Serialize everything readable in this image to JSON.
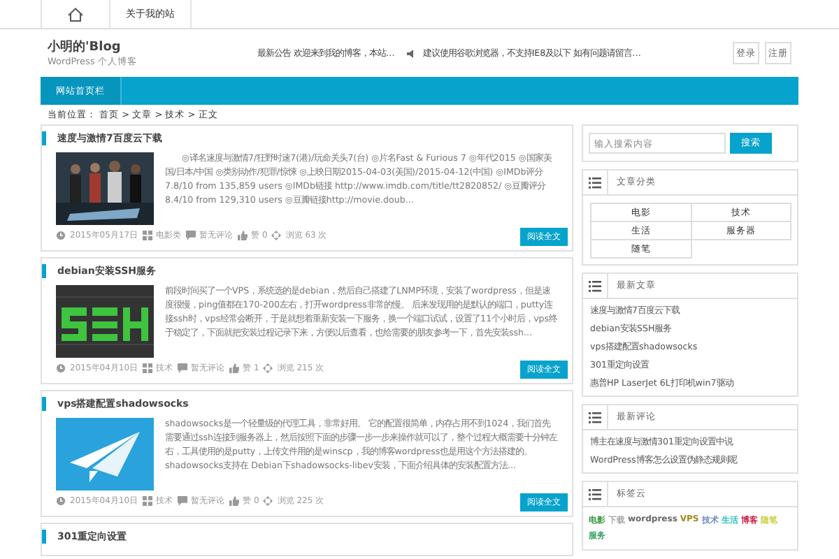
{
  "top_nav": {
    "label": "关于我的站"
  },
  "header": {
    "site_name": "小明的'Blog",
    "tagline": "WordPress 个人博客",
    "notices": [
      "最新公告 欢迎来到我的博客，本站…",
      "建议使用谷歌浏览器，不支持IE8及以下 如有问题请留言…"
    ],
    "buttons": [
      "登录",
      "注册"
    ]
  },
  "nav_bar": {
    "items": [
      {
        "label": "网站首页栏",
        "selected": true
      }
    ]
  },
  "breadcrumb": "当前位置： 首页 > 文章 > 技术 > 正文",
  "posts": [
    {
      "title": "速度与激情7百度云下载",
      "excerpt": "　　◎译名速度与激情7/狂野时速7(港)/玩命关头7(台) ◎片名Fast & Furious 7 ◎年代2015 ◎国家美国/日本/中国 ◎类别动作/犯罪/惊悚 ◎上映日期2015-04-03(美国)/2015-04-12(中国) ◎IMDb评分  7.8/10 from 135,859 users ◎IMDb链接  http://www.imdb.com/title/tt2820852/ ◎豆瓣评分8.4/10 from 129,310 users ◎豆瓣链接http://movie.doub...",
      "date": "2015年05月17日",
      "category": "电影类",
      "comments": "暂无评论",
      "likes": "赞 0",
      "views": "浏览 63 次",
      "button": "阅读全文"
    },
    {
      "title": "debian安装SSH服务",
      "excerpt": "前段时间买了一个VPS，系统选的是debian，然后自己搭建了LNMP环境，安装了wordpress，但是速度很慢，ping值都在170-200左右，打开wordpress非常的慢。 后来发现用的是默认的端口，putty连接ssh时，vps经常会断开，于是就想着重新安装一下服务，换一个端口试试，设置了11个小时后，vps终于稳定了，下面就把安装过程记录下来，方便以后查看，也给需要的朋友参考一下，首先安装ssh...",
      "date": "2015年04月10日",
      "category": "技术",
      "comments": "暂无评论",
      "likes": "赞 1",
      "views": "浏览 215 次",
      "button": "阅读全文"
    },
    {
      "title": "vps搭建配置shadowsocks",
      "excerpt": "shadowsocks是一个轻量级的代理工具，非常好用。 它的配置很简单，内存占用不到1024，我们首先需要通过ssh连接到服务器上，然后按照下面的步骤一步一步来操作就可以了，整个过程大概需要十分钟左右，工具使用的是putty，上传文件用的是winscp，我的博客wordpress也是用这个方法搭建的。 shadowsocks支持在 Debian下shadowsocks-libev安装，下面介绍具体的安装配置方法...",
      "date": "2015年04月10日",
      "category": "技术",
      "comments": "暂无评论",
      "likes": "赞 0",
      "views": "浏览 225 次",
      "button": "阅读全文"
    },
    {
      "title": "301重定向设置"
    }
  ],
  "sidebar": {
    "search": {
      "placeholder": "输入搜索内容",
      "button": "搜索"
    },
    "widgets": [
      {
        "kind": "categories",
        "title": "文章分类",
        "items": [
          "电影",
          "技术",
          "生活",
          "服务器",
          "随笔"
        ]
      },
      {
        "kind": "list",
        "title": "最新文章",
        "items": [
          "速度与激情7百度云下载",
          "debian安装SSH服务",
          "vps搭建配置shadowsocks",
          "301重定向设置",
          "惠普HP LaserJet 6L打印机win7驱动"
        ]
      },
      {
        "kind": "list",
        "title": "最新评论",
        "items": [
          "博主在速度与激情301重定向设置中说",
          "WordPress博客怎么设置伪静态规则呢"
        ]
      },
      {
        "kind": "tags",
        "title": "标签云",
        "items": [
          {
            "label": "电影",
            "color": "#3a9a3a"
          },
          {
            "label": "下载",
            "color": "#aaaaaa"
          },
          {
            "label": "wordpress",
            "color": "#666666"
          },
          {
            "label": "VPS",
            "color": "#a08a20"
          },
          {
            "label": "技术",
            "color": "#6a8ac0"
          },
          {
            "label": "生活",
            "color": "#30c0c0"
          },
          {
            "label": "博客",
            "color": "#d0204a"
          },
          {
            "label": "随笔",
            "color": "#c8d040"
          },
          {
            "label": "服务",
            "color": "#30a060"
          }
        ]
      }
    ]
  }
}
